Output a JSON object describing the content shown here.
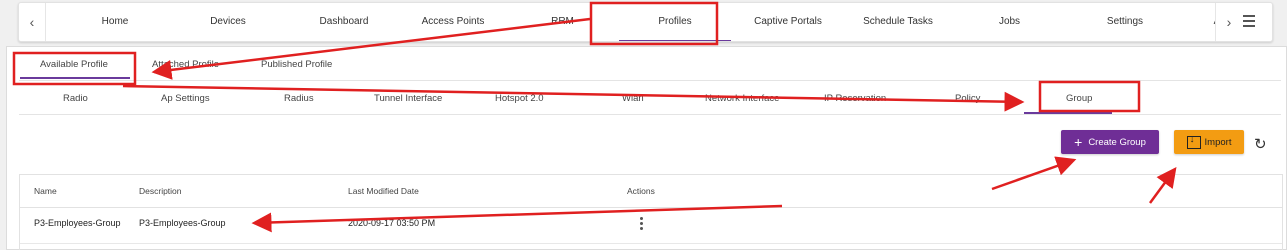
{
  "topnav": {
    "items": [
      "Home",
      "Devices",
      "Dashboard",
      "Access Points",
      "RRM",
      "Profiles",
      "Captive Portals",
      "Schedule Tasks",
      "Jobs",
      "Settings",
      "Audit"
    ],
    "active": "Profiles"
  },
  "subtabs": [
    "Available Profile",
    "Attached Profile",
    "Published Profile"
  ],
  "profile_tabs": [
    "Radio",
    "Ap Settings",
    "Radius",
    "Tunnel Interface",
    "Hotspot 2.0",
    "Wlan",
    "Network Interface",
    "IP Reservation",
    "Policy",
    "Group"
  ],
  "actions": {
    "create_label": "Create Group",
    "import_label": "Import"
  },
  "table": {
    "headers": [
      "Name",
      "Description",
      "Last Modified Date",
      "Actions"
    ],
    "rows": [
      {
        "name": "P3-Employees-Group",
        "description": "P3-Employees-Group",
        "modified": "2020-09-17 03:50 PM"
      }
    ]
  },
  "colors": {
    "accent": "#6a3a9c",
    "create_button": "#6f2e96",
    "import_button": "#f39c12",
    "annotation": "#e02020"
  }
}
